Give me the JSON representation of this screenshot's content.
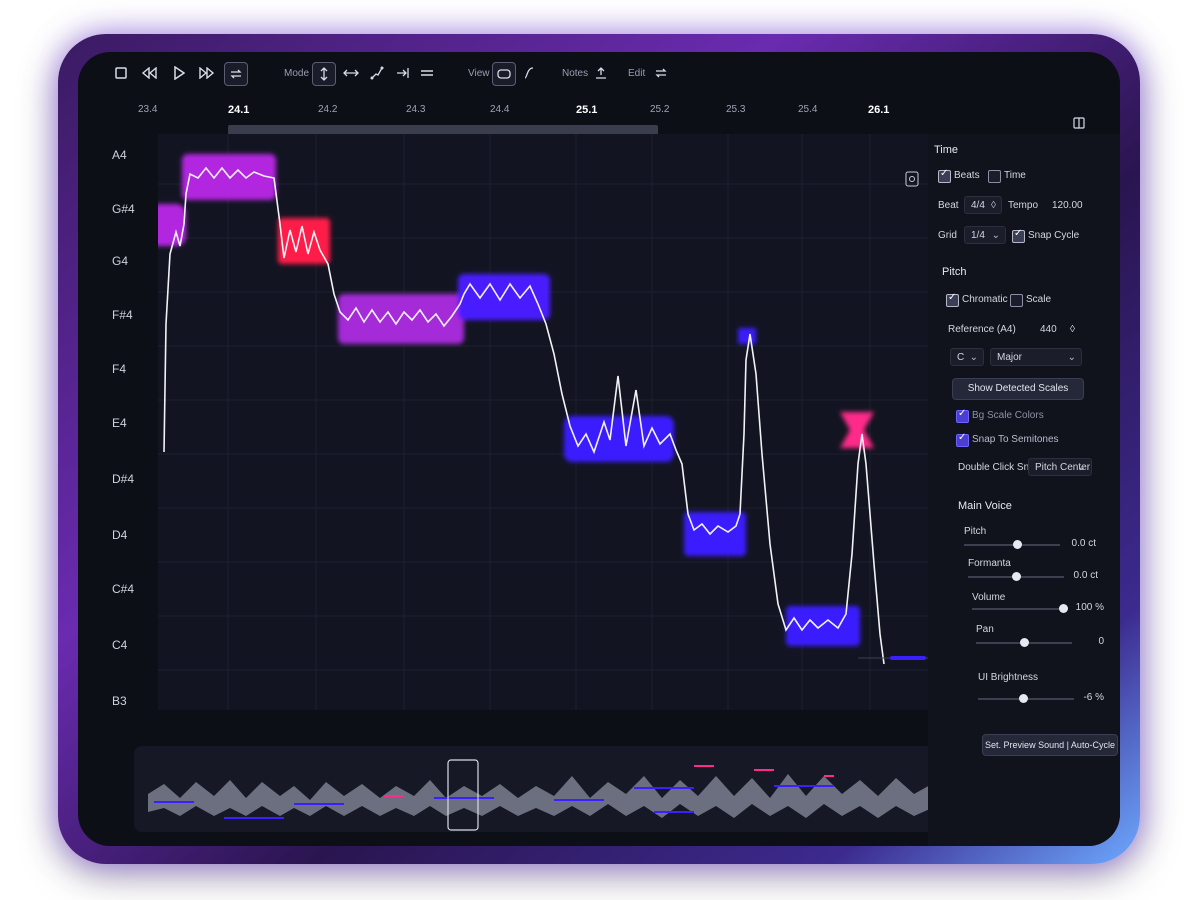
{
  "toolbar": {
    "mode_label": "Mode",
    "view_label": "View",
    "notes_label": "Notes",
    "edit_label": "Edit"
  },
  "ruler": {
    "labels": [
      "23.4",
      "24.1",
      "24.2",
      "24.3",
      "24.4",
      "25.1",
      "25.2",
      "25.3",
      "25.4",
      "26.1"
    ]
  },
  "piano": {
    "notes": [
      "A4",
      "G#4",
      "G4",
      "F#4",
      "F4",
      "E4",
      "D#4",
      "D4",
      "C#4",
      "C4",
      "B3"
    ]
  },
  "panel": {
    "time_title": "Time",
    "beats_label": "Beats",
    "beats_checked": true,
    "time_label": "Time",
    "time_checked": false,
    "beat_label": "Beat",
    "beat_value": "4/4",
    "tempo_label": "Tempo",
    "tempo_value": "120.00",
    "grid_label": "Grid",
    "grid_value": "1/4",
    "snap_cycle_label": "Snap Cycle",
    "pitch_title": "Pitch",
    "chromatic_label": "Chromatic",
    "scale_label": "Scale",
    "reference_label": "Reference (A4)",
    "reference_value": "440",
    "key_value": "C",
    "mode_value": "Major",
    "show_scales_button": "Show Detected Scales",
    "bg_scale_colors_label": "Bg Scale Colors",
    "snap_semitones_label": "Snap To Semitones",
    "double_click_label": "Double Click Snap",
    "double_click_value": "Pitch Center",
    "main_voice_title": "Main Voice",
    "pitch_label": "Pitch",
    "pitch_value": "0.0 ct",
    "pitch_level": 0.55,
    "formanta_label": "Formanta",
    "formanta_value": "0.0 ct",
    "formanta_level": 0.5,
    "volume_label": "Volume",
    "volume_value": "100 %",
    "volume_level": 0.95,
    "pan_label": "Pan",
    "pan_value": "0",
    "pan_level": 0.5,
    "ui_brightness_label": "UI Brightness",
    "ui_brightness_value": "-6 %",
    "ui_brightness_level": 0.47,
    "preview_button": "Set. Preview Sound | Auto-Cycle"
  },
  "colors": {
    "purple": "#b326e0",
    "red": "#ff1f4a",
    "blue": "#3a1fff",
    "pink": "#ff2a8a"
  }
}
